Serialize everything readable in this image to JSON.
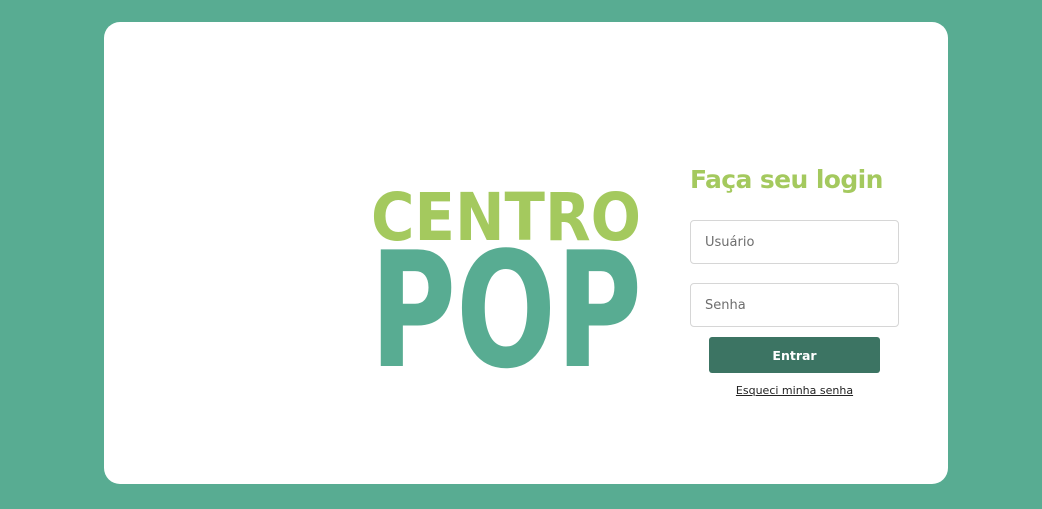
{
  "colors": {
    "page_background": "#58ac92",
    "card_background": "#ffffff",
    "logo_top": "#a4c95e",
    "logo_bottom": "#58ac92",
    "title": "#a4c95e",
    "button": "#3c7463",
    "button_text": "#ffffff"
  },
  "logo": {
    "line1": "CENTRO",
    "line2": "POP"
  },
  "login": {
    "title": "Faça seu login",
    "username_placeholder": "Usuário",
    "password_placeholder": "Senha",
    "submit_label": "Entrar",
    "forgot_link": "Esqueci minha senha"
  }
}
